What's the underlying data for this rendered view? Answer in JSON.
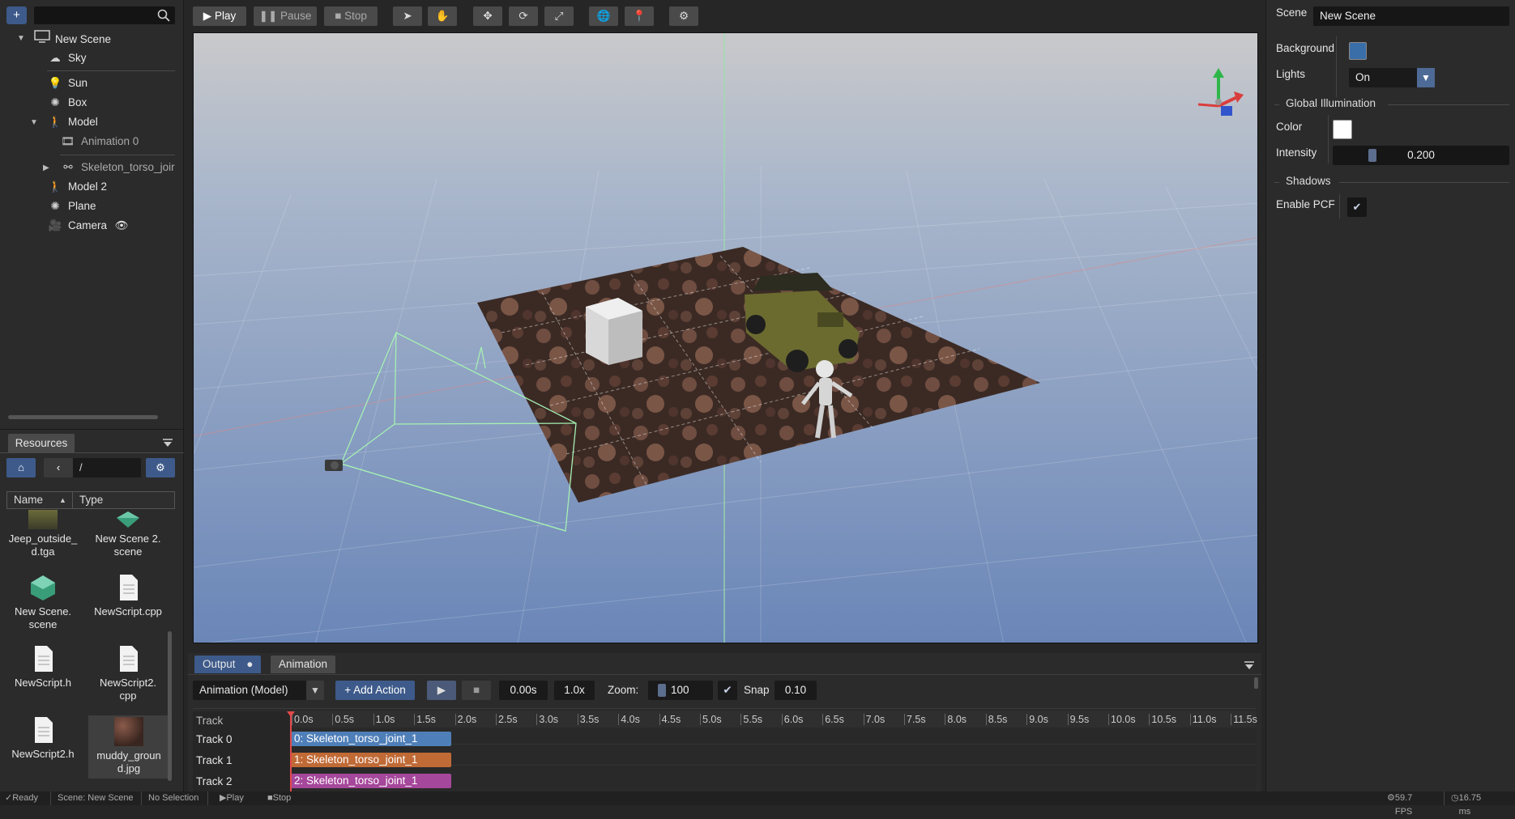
{
  "hierarchy": {
    "add_label": "+",
    "search_placeholder": "",
    "items": [
      {
        "label": "New Scene",
        "icon": "monitor-icon"
      },
      {
        "label": "Sky",
        "icon": "cloud-icon"
      },
      {
        "label": "Sun",
        "icon": "lightbulb-icon"
      },
      {
        "label": "Box",
        "icon": "mesh-icon"
      },
      {
        "label": "Model",
        "icon": "figure-icon"
      },
      {
        "label": "Animation 0",
        "icon": "film-icon"
      },
      {
        "label": "Skeleton_torso_joir",
        "icon": "bone-icon"
      },
      {
        "label": "Model 2",
        "icon": "figure-icon"
      },
      {
        "label": "Plane",
        "icon": "mesh-icon"
      },
      {
        "label": "Camera",
        "icon": "camera-icon"
      }
    ]
  },
  "resources": {
    "tab_label": "Resources",
    "path": "/",
    "col_name": "Name",
    "col_type": "Type",
    "files": [
      {
        "name": "Jeep_outside_\nd.tga",
        "icon": "image-icon"
      },
      {
        "name": "New Scene 2.\nscene",
        "icon": "scene-icon"
      },
      {
        "name": "New Scene.\nscene",
        "icon": "scene-icon"
      },
      {
        "name": "NewScript.cpp",
        "icon": "file-icon"
      },
      {
        "name": "NewScript.h",
        "icon": "file-icon"
      },
      {
        "name": "NewScript2.\ncpp",
        "icon": "file-icon"
      },
      {
        "name": "NewScript2.h",
        "icon": "file-icon"
      },
      {
        "name": "muddy_groun\nd.jpg",
        "icon": "image-icon"
      }
    ]
  },
  "toolbar": {
    "play": "Play",
    "pause": "Pause",
    "stop": "Stop"
  },
  "inspector": {
    "scene_label": "Scene",
    "scene_name": "New Scene",
    "background_label": "Background",
    "background_color": "#3a6ea8",
    "lights_label": "Lights",
    "lights_value": "On",
    "gi_section": "Global Illumination",
    "color_label": "Color",
    "color_value": "#ffffff",
    "intensity_label": "Intensity",
    "intensity_value": "0.200",
    "shadows_section": "Shadows",
    "pcf_label": "Enable PCF",
    "pcf_checked": true
  },
  "bottom": {
    "tab_output": "Output",
    "tab_animation": "Animation",
    "animation_select": "Animation (Model)",
    "add_action": "+ Add Action",
    "time": "0.00s",
    "speed": "1.0x",
    "zoom_label": "Zoom:",
    "zoom_value": "100",
    "snap_label": "Snap",
    "snap_value": "0.10",
    "track_header": "Track",
    "ruler": [
      "0.0s",
      "0.5s",
      "1.0s",
      "1.5s",
      "2.0s",
      "2.5s",
      "3.0s",
      "3.5s",
      "4.0s",
      "4.5s",
      "5.0s",
      "5.5s",
      "6.0s",
      "6.5s",
      "7.0s",
      "7.5s",
      "8.0s",
      "8.5s",
      "9.0s",
      "9.5s",
      "10.0s",
      "10.5s",
      "11.0s",
      "11.5s"
    ],
    "tracks": [
      {
        "name": "Track 0",
        "clip": "0: Skeleton_torso_joint_1",
        "color": "#4f7fb8"
      },
      {
        "name": "Track 1",
        "clip": "1: Skeleton_torso_joint_1",
        "color": "#c06a36"
      },
      {
        "name": "Track 2",
        "clip": "2: Skeleton_torso_joint_1",
        "color": "#a5479a"
      }
    ]
  },
  "status": {
    "ready": "Ready",
    "scene": "Scene: New Scene",
    "selection": "No Selection",
    "play": "Play",
    "stop": "Stop",
    "fps": "59.7 FPS",
    "ms": "16.75 ms"
  }
}
